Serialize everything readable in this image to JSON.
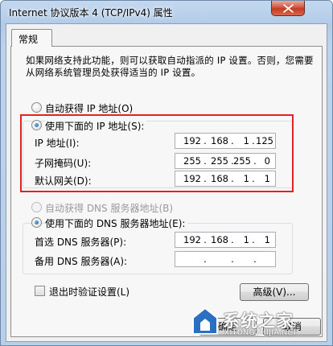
{
  "window": {
    "title": "Internet 协议版本 4 (TCP/IPv4) 属性",
    "close_glyph": "×"
  },
  "tabs": [
    {
      "label": "常规"
    }
  ],
  "description": "如果网络支持此功能，则可以获取自动指派的 IP 设置。否则，您需要从网络系统管理员处获得适当的 IP 设置。",
  "ip_section": {
    "auto_label": "自动获得 IP 地址(O)",
    "manual_label": "使用下面的 IP 地址(S):",
    "selected": "manual",
    "fields": [
      {
        "label": "IP 地址(I):",
        "octets": [
          "192",
          "168",
          "1",
          "125"
        ]
      },
      {
        "label": "子网掩码(U):",
        "octets": [
          "255",
          "255",
          "255",
          "0"
        ]
      },
      {
        "label": "默认网关(D):",
        "octets": [
          "192",
          "168",
          "1",
          "1"
        ]
      }
    ]
  },
  "dns_section": {
    "auto_label": "自动获得 DNS 服务器地址(B)",
    "manual_label": "使用下面的 DNS 服务器地址(E):",
    "selected": "manual",
    "fields": [
      {
        "label": "首选 DNS 服务器(P):",
        "octets": [
          "192",
          "168",
          "1",
          "1"
        ]
      },
      {
        "label": "备用 DNS 服务器(A):",
        "octets": [
          "",
          "",
          "",
          ""
        ]
      }
    ]
  },
  "validate_on_exit": {
    "label": "退出时验证设置(L)",
    "checked": false
  },
  "buttons": {
    "advanced": "高级(V)...",
    "ok": "确定",
    "cancel": "取消"
  },
  "watermark": {
    "text": "系统之家",
    "subtext": "XITONGZHIJIA.NET"
  },
  "colors": {
    "highlight": "#e02424",
    "titlebar": "#b1cbe8",
    "close_button": "#c53a22"
  }
}
